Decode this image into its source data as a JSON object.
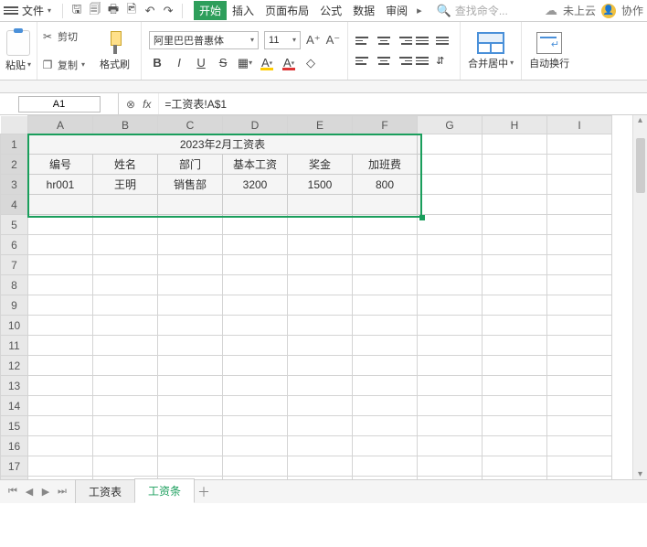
{
  "menubar": {
    "file_label": "文件",
    "search_placeholder": "查找命令...",
    "cloud_label": "未上云",
    "collab_label": "协作"
  },
  "tabs": {
    "items": [
      "开始",
      "插入",
      "页面布局",
      "公式",
      "数据",
      "审阅"
    ],
    "active_index": 0
  },
  "ribbon": {
    "paste_label": "粘贴",
    "cut_label": "剪切",
    "copy_label": "复制",
    "format_painter_label": "格式刷",
    "font_name": "阿里巴巴普惠体",
    "font_size": "11",
    "merge_label": "合并居中",
    "wrap_label": "自动换行"
  },
  "name_box": "A1",
  "formula": "=工资表!A$1",
  "columns": [
    "A",
    "B",
    "C",
    "D",
    "E",
    "F",
    "G",
    "H",
    "I"
  ],
  "row_count": 18,
  "selected_rows": [
    1,
    2,
    3,
    4
  ],
  "selected_cols": [
    "A",
    "B",
    "C",
    "D",
    "E",
    "F"
  ],
  "sheet": {
    "title_row": {
      "text": "2023年2月工资表",
      "span": 6
    },
    "header_row": [
      "编号",
      "姓名",
      "部门",
      "基本工资",
      "奖金",
      "加班费"
    ],
    "data_rows": [
      [
        "hr001",
        "王明",
        "销售部",
        "3200",
        "1500",
        "800"
      ]
    ]
  },
  "sheet_tabs": {
    "items": [
      "工资表",
      "工资条"
    ],
    "active_index": 1
  }
}
